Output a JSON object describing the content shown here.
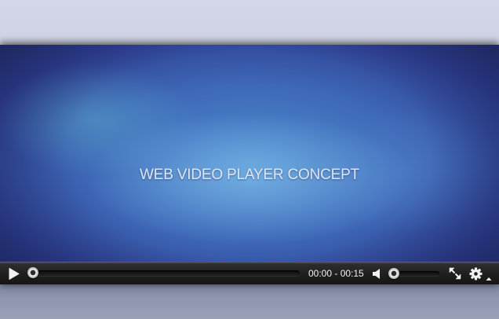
{
  "video": {
    "title_text": "WEB VIDEO PLAYER CONCEPT"
  },
  "controls": {
    "play_icon": "play-icon",
    "time_display": "00:00 - 00:15",
    "progress_fraction": 0.0,
    "volume_icon": "speaker-icon",
    "volume_fraction": 0.0,
    "fullscreen_icon": "fullscreen-icon",
    "settings_icon": "gear-icon",
    "menu_caret_icon": "caret-up-icon"
  },
  "colors": {
    "control_bar": "#1f1f1f",
    "icon": "#f2f2f2",
    "title_text": "#dfe6f2",
    "page_background": "#cfd3e3"
  }
}
